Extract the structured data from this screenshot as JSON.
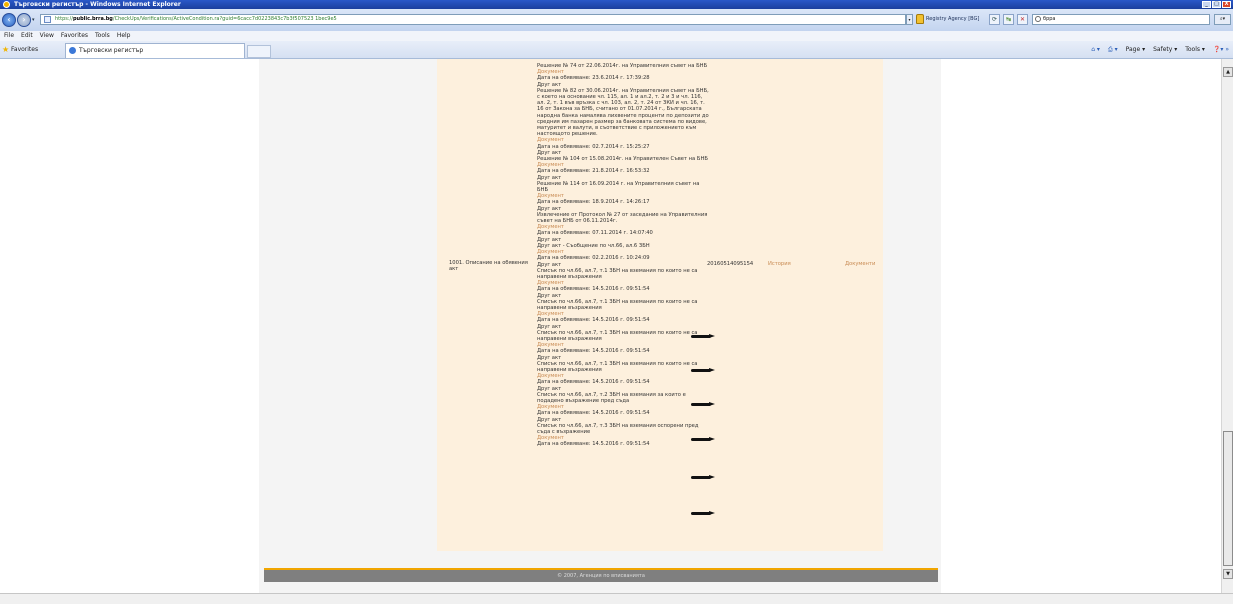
{
  "window": {
    "title": "Търговски регистър - Windows Internet Explorer",
    "controls": [
      "_",
      "□",
      "X"
    ]
  },
  "addressbar": {
    "url_https": "https://",
    "url_domain": "public.brra.bg",
    "url_path": "/CheckUps/Verifications/ActiveCondition.ra?guid=6cacc7d0223843c7b3f507523 1bec9e5",
    "site_identity": "Registry Agency [BG]",
    "search_value": "бppa"
  },
  "menubar": [
    "File",
    "Edit",
    "View",
    "Favorites",
    "Tools",
    "Help"
  ],
  "favbar": {
    "favorites_label": "Favorites",
    "tab_title": "Търговски регистър",
    "commands": [
      "Page ▾",
      "Safety ▾",
      "Tools ▾"
    ]
  },
  "record": {
    "field_label": "1001. Описание на обявения акт",
    "reg_number": "20160514095154",
    "history_label": "История",
    "documents_label": "Документи",
    "entries": [
      {
        "t": "Решение № 74 от 22.06.2014г. на Управителния съвет на БНБ",
        "link": false
      },
      {
        "t": "Документ",
        "link": true
      },
      {
        "t": "Дата на обявяване: 23.6.2014 г. 17:39:28",
        "link": false
      },
      {
        "t": "Друг акт",
        "link": false
      },
      {
        "t": "Решение № 82 от 30.06.2014г. на Управителния съвет на БНБ, с което на основание чл. 115, ал. 1 и ал.2, т. 2 и 3 и чл. 116, ал. 2, т. 1 във връзка с чл. 103, ал. 2, т. 24 от ЗКИ и чл. 16, т. 16 от Закона за БНБ, считано от 01.07.2014 г., Българската народна банка намалява лихвените проценти по депозити до средния им пазарен размер за банковата система по видове, матуритет и валути, в съответствие с приложението към настоящото решение.",
        "link": false
      },
      {
        "t": "Документ",
        "link": true
      },
      {
        "t": "Дата на обявяване: 02.7.2014 г. 15:25:27",
        "link": false
      },
      {
        "t": "Друг акт",
        "link": false
      },
      {
        "t": "Решение № 104 от 15.08.2014г. на Управителен Съвет на БНБ",
        "link": false
      },
      {
        "t": "Документ",
        "link": true
      },
      {
        "t": "Дата на обявяване: 21.8.2014 г. 16:53:32",
        "link": false
      },
      {
        "t": "Друг акт",
        "link": false
      },
      {
        "t": "Решение № 114 от 16.09.2014 г. на Управителния съвет на БНБ",
        "link": false
      },
      {
        "t": "Документ",
        "link": true
      },
      {
        "t": "Дата на обявяване: 18.9.2014 г. 14:26:17",
        "link": false
      },
      {
        "t": "Друг акт",
        "link": false
      },
      {
        "t": "Извлечение от Протокол № 27 от заседание на Управителния съвет на БНБ от 06.11.2014г.",
        "link": false
      },
      {
        "t": "Документ",
        "link": true
      },
      {
        "t": "Дата на обявяване: 07.11.2014 г. 14:07:40",
        "link": false
      },
      {
        "t": "Друг акт",
        "link": false
      },
      {
        "t": "Друг акт - Съобщение по чл.66, ал.6 ЗБН",
        "link": false
      },
      {
        "t": "Документ",
        "link": true
      },
      {
        "t": "Дата на обявяване: 02.2.2016 г. 10:24:09",
        "link": false
      },
      {
        "t": "Друг акт",
        "link": false
      },
      {
        "t": "Списък по чл.66, ал.7, т.1 ЗБН на вземания по които не са направени възражения",
        "link": false
      },
      {
        "t": "Документ",
        "link": true
      },
      {
        "t": "Дата на обявяване: 14.5.2016 г. 09:51:54",
        "link": false
      },
      {
        "t": "Друг акт",
        "link": false
      },
      {
        "t": "Списък по чл.66, ал.7, т.1 ЗБН на вземания по които не са направени възражения",
        "link": false
      },
      {
        "t": "Документ",
        "link": true
      },
      {
        "t": "Дата на обявяване: 14.5.2016 г. 09:51:54",
        "link": false
      },
      {
        "t": "Друг акт",
        "link": false
      },
      {
        "t": "Списък по чл.66, ал.7, т.1 ЗБН на вземания по които не са направени възражения",
        "link": false
      },
      {
        "t": "Документ",
        "link": true
      },
      {
        "t": "Дата на обявяване: 14.5.2016 г. 09:51:54",
        "link": false
      },
      {
        "t": "Друг акт",
        "link": false
      },
      {
        "t": "Списък по чл.66, ал.7, т.1 ЗБН на вземания по които не са направени възражения",
        "link": false
      },
      {
        "t": "Документ",
        "link": true
      },
      {
        "t": "Дата на обявяване: 14.5.2016 г. 09:51:54",
        "link": false
      },
      {
        "t": "Друг акт",
        "link": false
      },
      {
        "t": "Списък по чл.66, ал.7, т.2 ЗБН на вземания за които е подадено възражение пред съда",
        "link": false
      },
      {
        "t": "Документ",
        "link": true
      },
      {
        "t": "Дата на обявяване: 14.5.2016 г. 09:51:54",
        "link": false
      },
      {
        "t": "Друг акт",
        "link": false
      },
      {
        "t": "Списък по чл.66, ал.7, т.3 ЗБН на вземания оспорени пред съда с възражение",
        "link": false
      },
      {
        "t": "Документ",
        "link": true
      },
      {
        "t": "Дата на обявяване: 14.5.2016 г. 09:51:54",
        "link": false
      }
    ]
  },
  "footer": {
    "text": "© 2007, Агенция по вписванията"
  }
}
